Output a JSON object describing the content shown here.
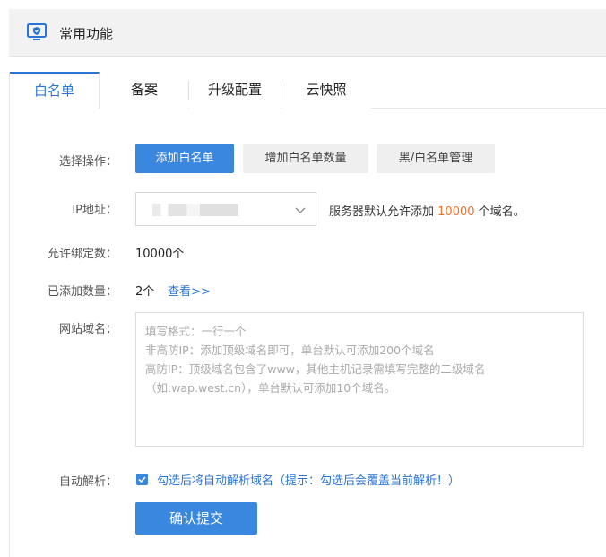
{
  "header": {
    "title": "常用功能",
    "icon": "monitor-shield-icon"
  },
  "tabs": [
    {
      "label": "白名单",
      "active": true
    },
    {
      "label": "备案",
      "active": false
    },
    {
      "label": "升级配置",
      "active": false
    },
    {
      "label": "云快照",
      "active": false
    }
  ],
  "form": {
    "operation": {
      "label": "选择操作：",
      "buttons": [
        "添加白名单",
        "增加白名单数量",
        "黑/白名单管理"
      ],
      "selected": "添加白名单"
    },
    "ip": {
      "label": "IP地址：",
      "note_prefix": "服务器默认允许添加",
      "note_count": "10000",
      "note_suffix": "个域名。"
    },
    "allowed": {
      "label": "允许绑定数：",
      "value": "10000个"
    },
    "added": {
      "label": "已添加数量：",
      "value": "2个",
      "link": "查看>>"
    },
    "domains": {
      "label": "网站域名：",
      "placeholder": "填写格式：一行一个\n非高防IP：添加顶级域名即可，单台默认可添加200个域名\n高防IP：顶级域名包含了www，其他主机记录需填写完整的二级域名\n（如:wap.west.cn），单台默认可添加10个域名。"
    },
    "auto_resolve": {
      "label": "自动解析：",
      "checked": true,
      "text": "勾选后将自动解析域名（提示：勾选后会覆盖当前解析！）"
    },
    "submit": "确认提交"
  },
  "colors": {
    "accent": "#3a87e0",
    "link": "#2a74d5",
    "highlight": "#f0712c"
  }
}
